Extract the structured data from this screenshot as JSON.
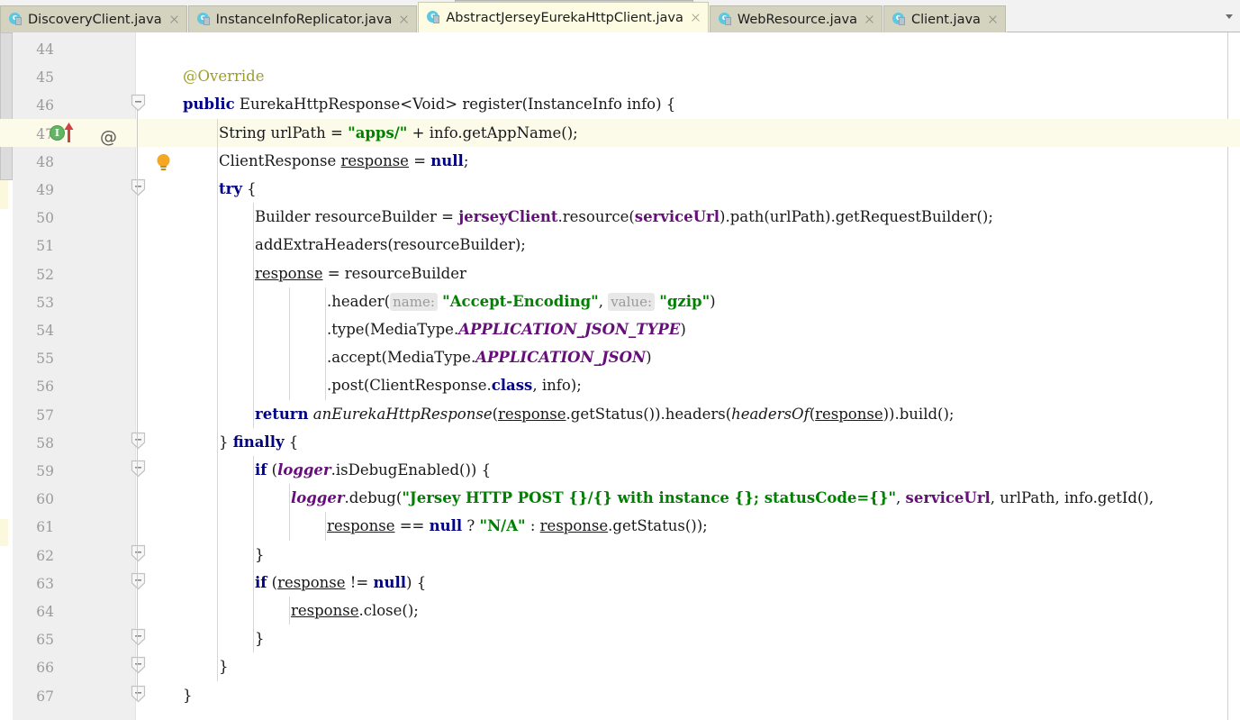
{
  "window": {
    "app": "IntelliJ IDEA Editor",
    "active_file": "AbstractJerseyEurekaHttpClient.java"
  },
  "colors": {
    "tab_inactive_bg": "#d3d3c0",
    "tab_active_bg": "#fdfce3",
    "gutter_bg": "#efefef",
    "caret_row_bg": "#fcfae8",
    "keyword": "#000084",
    "string": "#008000",
    "annotation": "#9e9e2e",
    "static_field": "#660e7a",
    "line_number": "#9b9b9b",
    "hint_chip_bg": "#e8e8e8",
    "hint_chip_text": "#9a9a9a",
    "impl_marker_green": "#62b562",
    "override_arrow_red": "#cf4040",
    "bulb_yellow": "#f5a623"
  },
  "tabs": {
    "items": [
      {
        "label": "DiscoveryClient.java",
        "icon": "java-class-icon",
        "active": false,
        "truncated": false
      },
      {
        "label": "InstanceInfoReplicator.java",
        "icon": "java-class-icon",
        "active": false,
        "truncated": true
      },
      {
        "label": "AbstractJerseyEurekaHttpClient.java",
        "icon": "java-class-icon",
        "active": true,
        "truncated": false
      },
      {
        "label": "WebResource.java",
        "icon": "java-class-icon",
        "active": false,
        "truncated": false
      },
      {
        "label": "Client.java",
        "icon": "java-class-icon",
        "active": false,
        "truncated": false
      }
    ],
    "overflow_icon": "chevron-down-icon"
  },
  "gutter": {
    "icons": [
      {
        "name": "implementing-method-icon",
        "glyph": "I",
        "line": 46
      },
      {
        "name": "override-arrow-icon",
        "line": 46
      },
      {
        "name": "annotation-at-icon",
        "glyph": "@",
        "line": 46
      },
      {
        "name": "intention-bulb-icon",
        "line": 47
      }
    ],
    "fold_lines": [
      46,
      49,
      58,
      59,
      62,
      63,
      65,
      66,
      67
    ]
  },
  "editor": {
    "first_line": 44,
    "caret_line": 47,
    "lines": [
      {
        "n": 44,
        "indent": 0,
        "tokens": []
      },
      {
        "n": 45,
        "indent": 0,
        "tokens": [
          {
            "t": "@Override",
            "c": "ann"
          }
        ]
      },
      {
        "n": 46,
        "indent": 0,
        "tokens": [
          {
            "t": "public",
            "c": "kw"
          },
          {
            "t": " EurekaHttpResponse<Void> register(InstanceInfo info) {",
            "c": ""
          }
        ]
      },
      {
        "n": 47,
        "indent": 1,
        "tokens": [
          {
            "t": "String urlPath = ",
            "c": ""
          },
          {
            "t": "\"apps/\"",
            "c": "str"
          },
          {
            "t": " + info.getAppName();",
            "c": ""
          }
        ]
      },
      {
        "n": 48,
        "indent": 1,
        "tokens": [
          {
            "t": "ClientResponse ",
            "c": ""
          },
          {
            "t": "response",
            "c": "und"
          },
          {
            "t": " = ",
            "c": ""
          },
          {
            "t": "null",
            "c": "kw"
          },
          {
            "t": ";",
            "c": ""
          }
        ]
      },
      {
        "n": 49,
        "indent": 1,
        "tokens": [
          {
            "t": "try",
            "c": "kw"
          },
          {
            "t": " {",
            "c": ""
          }
        ]
      },
      {
        "n": 50,
        "indent": 2,
        "tokens": [
          {
            "t": "Builder resourceBuilder = ",
            "c": ""
          },
          {
            "t": "jerseyClient",
            "c": "fld"
          },
          {
            "t": ".resource(",
            "c": ""
          },
          {
            "t": "serviceUrl",
            "c": "fld"
          },
          {
            "t": ").path(urlPath).getRequestBuilder();",
            "c": ""
          }
        ]
      },
      {
        "n": 51,
        "indent": 2,
        "tokens": [
          {
            "t": "addExtraHeaders(resourceBuilder);",
            "c": ""
          }
        ]
      },
      {
        "n": 52,
        "indent": 2,
        "tokens": [
          {
            "t": "response",
            "c": "und"
          },
          {
            "t": " = resourceBuilder",
            "c": ""
          }
        ]
      },
      {
        "n": 53,
        "indent": 4,
        "tokens": [
          {
            "t": ".header(",
            "c": ""
          },
          {
            "t": "name:",
            "c": "hint"
          },
          {
            "t": " ",
            "c": ""
          },
          {
            "t": "\"Accept-Encoding\"",
            "c": "str"
          },
          {
            "t": ", ",
            "c": ""
          },
          {
            "t": "value:",
            "c": "hint"
          },
          {
            "t": " ",
            "c": ""
          },
          {
            "t": "\"gzip\"",
            "c": "str"
          },
          {
            "t": ")",
            "c": ""
          }
        ]
      },
      {
        "n": 54,
        "indent": 4,
        "tokens": [
          {
            "t": ".type(MediaType.",
            "c": ""
          },
          {
            "t": "APPLICATION_JSON_TYPE",
            "c": "stat"
          },
          {
            "t": ")",
            "c": ""
          }
        ]
      },
      {
        "n": 55,
        "indent": 4,
        "tokens": [
          {
            "t": ".accept(MediaType.",
            "c": ""
          },
          {
            "t": "APPLICATION_JSON",
            "c": "stat"
          },
          {
            "t": ")",
            "c": ""
          }
        ]
      },
      {
        "n": 56,
        "indent": 4,
        "tokens": [
          {
            "t": ".post(ClientResponse.",
            "c": ""
          },
          {
            "t": "class",
            "c": "kw"
          },
          {
            "t": ", info);",
            "c": ""
          }
        ]
      },
      {
        "n": 57,
        "indent": 2,
        "tokens": [
          {
            "t": "return",
            "c": "kw"
          },
          {
            "t": " ",
            "c": ""
          },
          {
            "t": "anEurekaHttpResponse",
            "c": "simp"
          },
          {
            "t": "(",
            "c": ""
          },
          {
            "t": "response",
            "c": "und"
          },
          {
            "t": ".getStatus()).headers(",
            "c": ""
          },
          {
            "t": "headersOf",
            "c": "simp"
          },
          {
            "t": "(",
            "c": ""
          },
          {
            "t": "response",
            "c": "und"
          },
          {
            "t": ")).build();",
            "c": ""
          }
        ]
      },
      {
        "n": 58,
        "indent": 1,
        "tokens": [
          {
            "t": "} ",
            "c": ""
          },
          {
            "t": "finally",
            "c": "kw"
          },
          {
            "t": " {",
            "c": ""
          }
        ]
      },
      {
        "n": 59,
        "indent": 2,
        "tokens": [
          {
            "t": "if",
            "c": "kw"
          },
          {
            "t": " (",
            "c": ""
          },
          {
            "t": "logger",
            "c": "fld-i"
          },
          {
            "t": ".isDebugEnabled()) {",
            "c": ""
          }
        ]
      },
      {
        "n": 60,
        "indent": 3,
        "tokens": [
          {
            "t": "logger",
            "c": "fld-i"
          },
          {
            "t": ".debug(",
            "c": ""
          },
          {
            "t": "\"Jersey HTTP POST {}/{} with instance {}; statusCode={}\"",
            "c": "str"
          },
          {
            "t": ", ",
            "c": ""
          },
          {
            "t": "serviceUrl",
            "c": "fld"
          },
          {
            "t": ", urlPath, info.getId(),",
            "c": ""
          }
        ]
      },
      {
        "n": 61,
        "indent": 4,
        "tokens": [
          {
            "t": "response",
            "c": "und"
          },
          {
            "t": " == ",
            "c": ""
          },
          {
            "t": "null",
            "c": "kw"
          },
          {
            "t": " ? ",
            "c": ""
          },
          {
            "t": "\"N/A\"",
            "c": "str"
          },
          {
            "t": " : ",
            "c": ""
          },
          {
            "t": "response",
            "c": "und"
          },
          {
            "t": ".getStatus());",
            "c": ""
          }
        ]
      },
      {
        "n": 62,
        "indent": 2,
        "tokens": [
          {
            "t": "}",
            "c": ""
          }
        ]
      },
      {
        "n": 63,
        "indent": 2,
        "tokens": [
          {
            "t": "if",
            "c": "kw"
          },
          {
            "t": " (",
            "c": ""
          },
          {
            "t": "response",
            "c": "und"
          },
          {
            "t": " != ",
            "c": ""
          },
          {
            "t": "null",
            "c": "kw"
          },
          {
            "t": ") {",
            "c": ""
          }
        ]
      },
      {
        "n": 64,
        "indent": 3,
        "tokens": [
          {
            "t": "response",
            "c": "und"
          },
          {
            "t": ".close();",
            "c": ""
          }
        ]
      },
      {
        "n": 65,
        "indent": 2,
        "tokens": [
          {
            "t": "}",
            "c": ""
          }
        ]
      },
      {
        "n": 66,
        "indent": 1,
        "tokens": [
          {
            "t": "}",
            "c": ""
          }
        ]
      },
      {
        "n": 67,
        "indent": 0,
        "tokens": [
          {
            "t": "}",
            "c": ""
          }
        ]
      }
    ]
  }
}
